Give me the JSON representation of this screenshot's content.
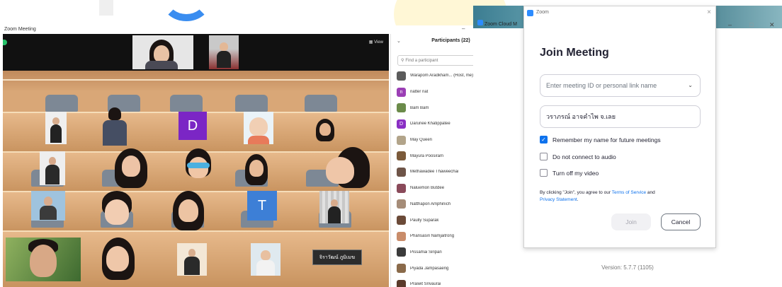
{
  "meeting_window": {
    "title": "Zoom Meeting",
    "controls": [
      "–",
      "⧉",
      "✕"
    ],
    "view_label": "View",
    "gallery": {
      "name_plate": "จิราวัฒน์ ภูมิเมฆ",
      "letter_tiles": [
        "D",
        "T"
      ]
    },
    "participants": {
      "header": "Participants (22)",
      "search_placeholder": "Find a participant",
      "list": [
        {
          "name": "Warapom Aradkham... (Host, me)",
          "mic": "on",
          "cam": "off"
        },
        {
          "name": "natter nat",
          "mic": "on",
          "cam": "off",
          "avatar_letter": "n"
        },
        {
          "name": "Bam Bam",
          "mic": "muted",
          "cam": "off"
        },
        {
          "name": "Darunee Khatippatee",
          "mic": "muted",
          "cam": "muted",
          "avatar_letter": "D"
        },
        {
          "name": "May Queen",
          "mic": "muted",
          "cam": "muted"
        },
        {
          "name": "Mayura Poosiram",
          "mic": "muted",
          "cam": "off"
        },
        {
          "name": "Methawadee Thaweechai",
          "mic": "muted",
          "cam": "off"
        },
        {
          "name": "Naluemon Butdee",
          "mic": "muted",
          "cam": "muted"
        },
        {
          "name": "Natthapon Amphinich",
          "mic": "muted",
          "cam": "off"
        },
        {
          "name": "Paully Suparak",
          "mic": "muted",
          "cam": "muted"
        },
        {
          "name": "Phansasiri Namjaitrong",
          "mic": "muted",
          "cam": "muted"
        },
        {
          "name": "Pissamai Siripan",
          "mic": "muted",
          "cam": "off"
        },
        {
          "name": "Piyada Jampasaeng",
          "mic": "muted",
          "cam": "off"
        },
        {
          "name": "Praiwit Srivaurai",
          "mic": "muted",
          "cam": "muted"
        }
      ]
    }
  },
  "cloud_window": {
    "tab_title": "Zoom Cloud M",
    "controls": [
      "–",
      "□",
      "✕"
    ],
    "version": "Version: 5.7.7 (1105)"
  },
  "join_dialog": {
    "app_name": "Zoom",
    "title": "Join Meeting",
    "meeting_id_placeholder": "Enter meeting ID or personal link name",
    "name_value": "วราภรณ์ อาจคำไพ จ.เลย",
    "options": [
      {
        "label": "Remember my name for future meetings",
        "checked": true
      },
      {
        "label": "Do not connect to audio",
        "checked": false
      },
      {
        "label": "Turn off my video",
        "checked": false
      }
    ],
    "terms_prefix": "By clicking \"Join\", you agree to our ",
    "terms_link": "Terms of Service",
    "terms_and": " and",
    "privacy_link": "Privacy Statement",
    "terms_suffix": ".",
    "join_label": "Join",
    "cancel_label": "Cancel"
  },
  "colors": {
    "zoom_blue": "#0e72ed",
    "muted_red": "#e4383a",
    "bleacher_wood": "#d9a777"
  }
}
